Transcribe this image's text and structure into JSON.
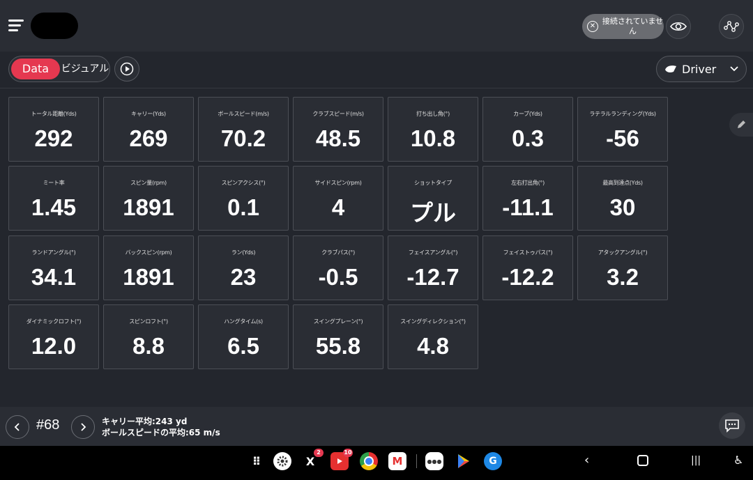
{
  "header": {
    "connection_status": "接続されていません"
  },
  "toolbar": {
    "data_label": "Data",
    "visual_label": "ビジュアル",
    "club_label": "Driver"
  },
  "metrics": [
    {
      "label": "トータル距離(Yds)",
      "value": "292"
    },
    {
      "label": "キャリー(Yds)",
      "value": "269"
    },
    {
      "label": "ボールスピード(m/s)",
      "value": "70.2"
    },
    {
      "label": "クラブスピード(m/s)",
      "value": "48.5"
    },
    {
      "label": "打ち出し角(°)",
      "value": "10.8"
    },
    {
      "label": "カーブ(Yds)",
      "value": "0.3"
    },
    {
      "label": "ラテラルランディング(Yds)",
      "value": "-56"
    },
    {
      "label": "ミート率",
      "value": "1.45"
    },
    {
      "label": "スピン量(rpm)",
      "value": "1891"
    },
    {
      "label": "スピンアクシス(°)",
      "value": "0.1"
    },
    {
      "label": "サイドスピン(rpm)",
      "value": "4"
    },
    {
      "label": "ショットタイプ",
      "value": "プル"
    },
    {
      "label": "左右打出角(°)",
      "value": "-11.1"
    },
    {
      "label": "最高到達点(Yds)",
      "value": "30"
    },
    {
      "label": "ランドアングル(°)",
      "value": "34.1"
    },
    {
      "label": "バックスピン(rpm)",
      "value": "1891"
    },
    {
      "label": "ラン(Yds)",
      "value": "23"
    },
    {
      "label": "クラブパス(°)",
      "value": "-0.5"
    },
    {
      "label": "フェイスアングル(°)",
      "value": "-12.7"
    },
    {
      "label": "フェイストゥパス(°)",
      "value": "-12.2"
    },
    {
      "label": "アタックアングル(°)",
      "value": "3.2"
    },
    {
      "label": "ダイナミックロフト(°)",
      "value": "12.0"
    },
    {
      "label": "スピンロフト(°)",
      "value": "8.8"
    },
    {
      "label": "ハングタイム(s)",
      "value": "6.5"
    },
    {
      "label": "スイングプレーン(°)",
      "value": "55.8"
    },
    {
      "label": "スイングディレクション(°)",
      "value": "4.8"
    }
  ],
  "footer": {
    "shot_number": "#68",
    "carry_avg": "キャリー平均:243 yd",
    "ball_speed_avg": "ボールスピードの平均:65 m/s"
  },
  "system_bar": {
    "apps": [
      {
        "name": "apps-grid-icon"
      },
      {
        "name": "settings-app-icon"
      },
      {
        "name": "x-app-icon",
        "badge": "2"
      },
      {
        "name": "youtube-app-icon",
        "badge": "10"
      },
      {
        "name": "chrome-app-icon"
      },
      {
        "name": "gmail-app-icon"
      },
      {
        "name": "golf-app-icon"
      },
      {
        "name": "play-store-icon"
      },
      {
        "name": "browser-app-icon"
      }
    ]
  },
  "colors": {
    "accent": "#e53850",
    "background": "#23262d",
    "cell": "#2a2d34"
  }
}
